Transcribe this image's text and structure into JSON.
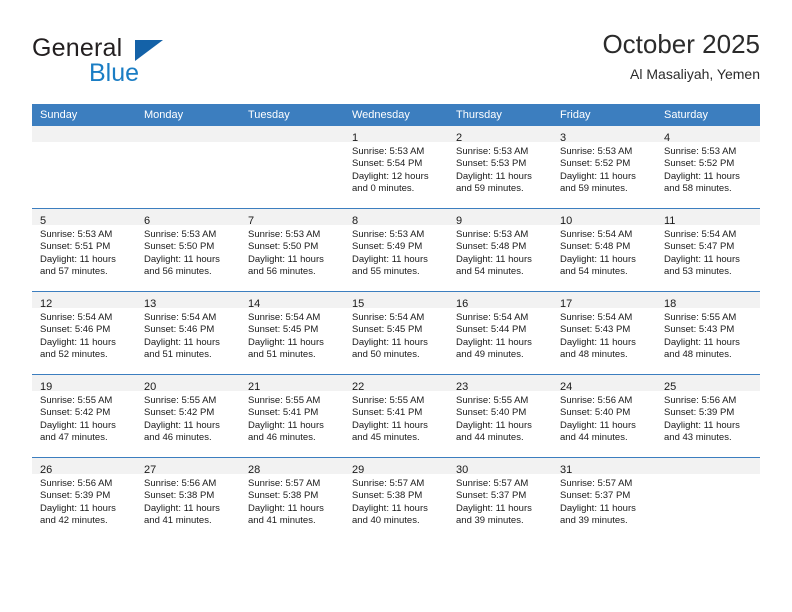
{
  "brand": {
    "name_part1": "General",
    "name_part2": "Blue",
    "logo_icon": "triangle-flag-icon"
  },
  "header": {
    "title": "October 2025",
    "subtitle": "Al Masaliyah, Yemen"
  },
  "calendar": {
    "weekday_headers": [
      "Sunday",
      "Monday",
      "Tuesday",
      "Wednesday",
      "Thursday",
      "Friday",
      "Saturday"
    ],
    "accent_color": "#3c7ebf",
    "daynum_bar_color": "#f2f2f2",
    "weeks": [
      [
        {
          "day": "",
          "lines": []
        },
        {
          "day": "",
          "lines": []
        },
        {
          "day": "",
          "lines": []
        },
        {
          "day": "1",
          "lines": [
            "Sunrise: 5:53 AM",
            "Sunset: 5:54 PM",
            "Daylight: 12 hours",
            "and 0 minutes."
          ]
        },
        {
          "day": "2",
          "lines": [
            "Sunrise: 5:53 AM",
            "Sunset: 5:53 PM",
            "Daylight: 11 hours",
            "and 59 minutes."
          ]
        },
        {
          "day": "3",
          "lines": [
            "Sunrise: 5:53 AM",
            "Sunset: 5:52 PM",
            "Daylight: 11 hours",
            "and 59 minutes."
          ]
        },
        {
          "day": "4",
          "lines": [
            "Sunrise: 5:53 AM",
            "Sunset: 5:52 PM",
            "Daylight: 11 hours",
            "and 58 minutes."
          ]
        }
      ],
      [
        {
          "day": "5",
          "lines": [
            "Sunrise: 5:53 AM",
            "Sunset: 5:51 PM",
            "Daylight: 11 hours",
            "and 57 minutes."
          ]
        },
        {
          "day": "6",
          "lines": [
            "Sunrise: 5:53 AM",
            "Sunset: 5:50 PM",
            "Daylight: 11 hours",
            "and 56 minutes."
          ]
        },
        {
          "day": "7",
          "lines": [
            "Sunrise: 5:53 AM",
            "Sunset: 5:50 PM",
            "Daylight: 11 hours",
            "and 56 minutes."
          ]
        },
        {
          "day": "8",
          "lines": [
            "Sunrise: 5:53 AM",
            "Sunset: 5:49 PM",
            "Daylight: 11 hours",
            "and 55 minutes."
          ]
        },
        {
          "day": "9",
          "lines": [
            "Sunrise: 5:53 AM",
            "Sunset: 5:48 PM",
            "Daylight: 11 hours",
            "and 54 minutes."
          ]
        },
        {
          "day": "10",
          "lines": [
            "Sunrise: 5:54 AM",
            "Sunset: 5:48 PM",
            "Daylight: 11 hours",
            "and 54 minutes."
          ]
        },
        {
          "day": "11",
          "lines": [
            "Sunrise: 5:54 AM",
            "Sunset: 5:47 PM",
            "Daylight: 11 hours",
            "and 53 minutes."
          ]
        }
      ],
      [
        {
          "day": "12",
          "lines": [
            "Sunrise: 5:54 AM",
            "Sunset: 5:46 PM",
            "Daylight: 11 hours",
            "and 52 minutes."
          ]
        },
        {
          "day": "13",
          "lines": [
            "Sunrise: 5:54 AM",
            "Sunset: 5:46 PM",
            "Daylight: 11 hours",
            "and 51 minutes."
          ]
        },
        {
          "day": "14",
          "lines": [
            "Sunrise: 5:54 AM",
            "Sunset: 5:45 PM",
            "Daylight: 11 hours",
            "and 51 minutes."
          ]
        },
        {
          "day": "15",
          "lines": [
            "Sunrise: 5:54 AM",
            "Sunset: 5:45 PM",
            "Daylight: 11 hours",
            "and 50 minutes."
          ]
        },
        {
          "day": "16",
          "lines": [
            "Sunrise: 5:54 AM",
            "Sunset: 5:44 PM",
            "Daylight: 11 hours",
            "and 49 minutes."
          ]
        },
        {
          "day": "17",
          "lines": [
            "Sunrise: 5:54 AM",
            "Sunset: 5:43 PM",
            "Daylight: 11 hours",
            "and 48 minutes."
          ]
        },
        {
          "day": "18",
          "lines": [
            "Sunrise: 5:55 AM",
            "Sunset: 5:43 PM",
            "Daylight: 11 hours",
            "and 48 minutes."
          ]
        }
      ],
      [
        {
          "day": "19",
          "lines": [
            "Sunrise: 5:55 AM",
            "Sunset: 5:42 PM",
            "Daylight: 11 hours",
            "and 47 minutes."
          ]
        },
        {
          "day": "20",
          "lines": [
            "Sunrise: 5:55 AM",
            "Sunset: 5:42 PM",
            "Daylight: 11 hours",
            "and 46 minutes."
          ]
        },
        {
          "day": "21",
          "lines": [
            "Sunrise: 5:55 AM",
            "Sunset: 5:41 PM",
            "Daylight: 11 hours",
            "and 46 minutes."
          ]
        },
        {
          "day": "22",
          "lines": [
            "Sunrise: 5:55 AM",
            "Sunset: 5:41 PM",
            "Daylight: 11 hours",
            "and 45 minutes."
          ]
        },
        {
          "day": "23",
          "lines": [
            "Sunrise: 5:55 AM",
            "Sunset: 5:40 PM",
            "Daylight: 11 hours",
            "and 44 minutes."
          ]
        },
        {
          "day": "24",
          "lines": [
            "Sunrise: 5:56 AM",
            "Sunset: 5:40 PM",
            "Daylight: 11 hours",
            "and 44 minutes."
          ]
        },
        {
          "day": "25",
          "lines": [
            "Sunrise: 5:56 AM",
            "Sunset: 5:39 PM",
            "Daylight: 11 hours",
            "and 43 minutes."
          ]
        }
      ],
      [
        {
          "day": "26",
          "lines": [
            "Sunrise: 5:56 AM",
            "Sunset: 5:39 PM",
            "Daylight: 11 hours",
            "and 42 minutes."
          ]
        },
        {
          "day": "27",
          "lines": [
            "Sunrise: 5:56 AM",
            "Sunset: 5:38 PM",
            "Daylight: 11 hours",
            "and 41 minutes."
          ]
        },
        {
          "day": "28",
          "lines": [
            "Sunrise: 5:57 AM",
            "Sunset: 5:38 PM",
            "Daylight: 11 hours",
            "and 41 minutes."
          ]
        },
        {
          "day": "29",
          "lines": [
            "Sunrise: 5:57 AM",
            "Sunset: 5:38 PM",
            "Daylight: 11 hours",
            "and 40 minutes."
          ]
        },
        {
          "day": "30",
          "lines": [
            "Sunrise: 5:57 AM",
            "Sunset: 5:37 PM",
            "Daylight: 11 hours",
            "and 39 minutes."
          ]
        },
        {
          "day": "31",
          "lines": [
            "Sunrise: 5:57 AM",
            "Sunset: 5:37 PM",
            "Daylight: 11 hours",
            "and 39 minutes."
          ]
        },
        {
          "day": "",
          "lines": []
        }
      ]
    ]
  }
}
